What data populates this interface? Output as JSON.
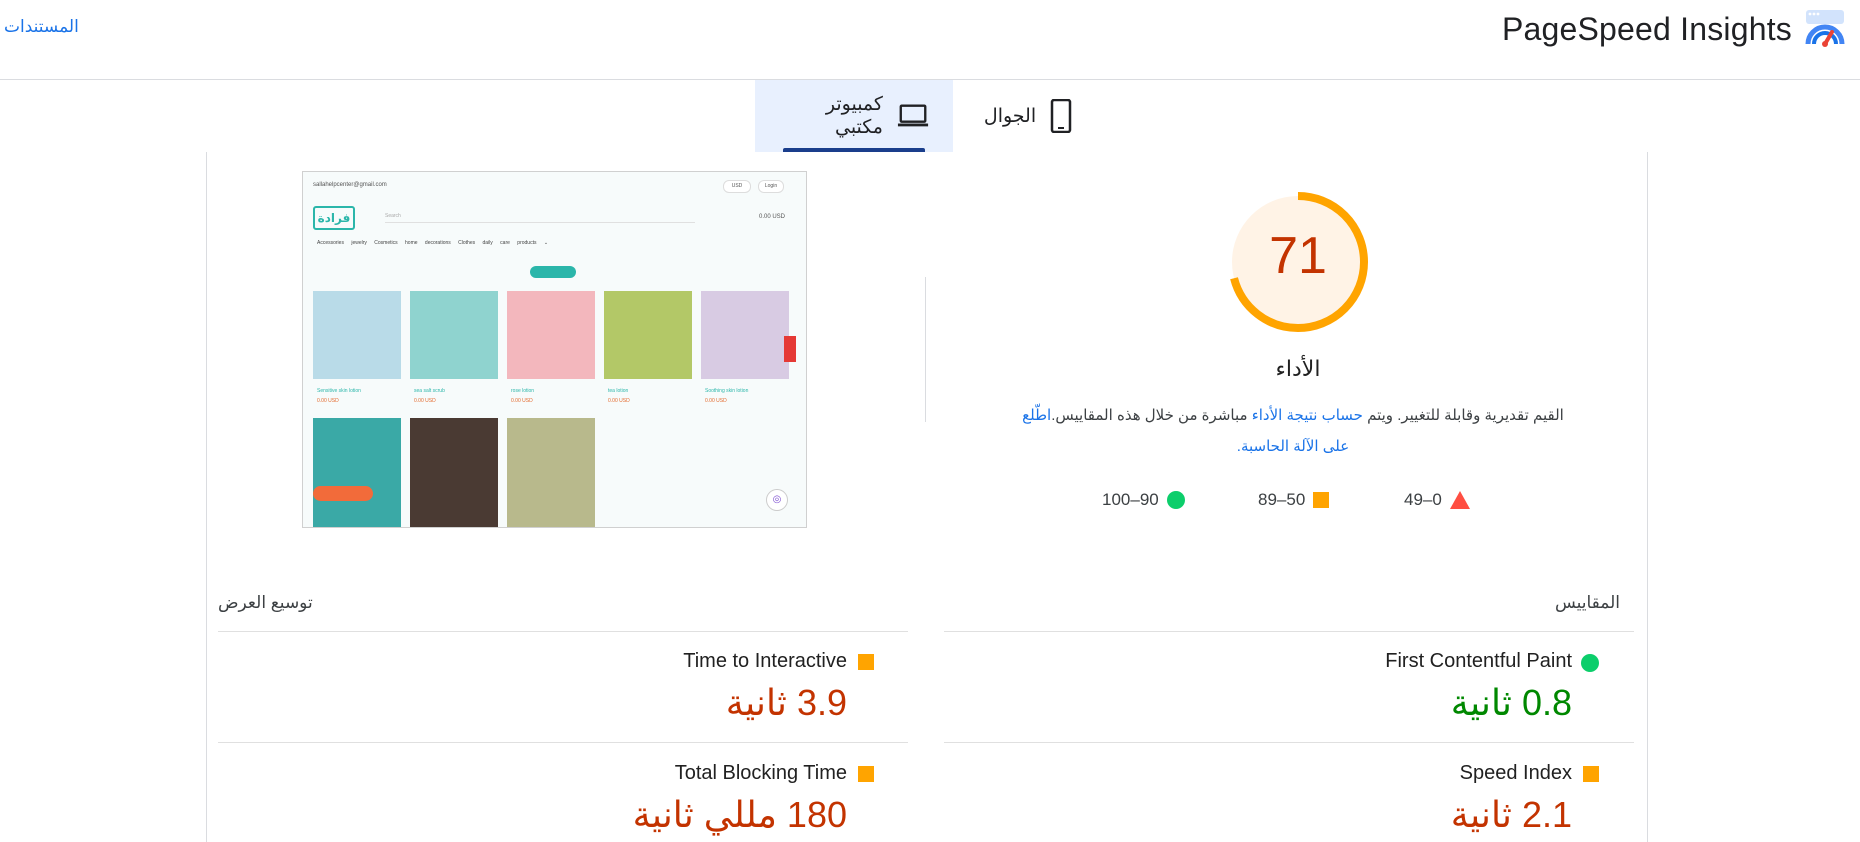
{
  "header": {
    "title": "PageSpeed Insights",
    "docs_link": "المستندات",
    "logo_icon": "pagespeed-gauge-logo"
  },
  "tabs": [
    {
      "label": "الجوال",
      "icon": "mobile-phone-icon",
      "active": false
    },
    {
      "label": "كمبيوتر مكتبي",
      "icon": "laptop-icon",
      "active": true
    }
  ],
  "score": {
    "value": "71",
    "fraction": 0.71,
    "label": "الأداء",
    "desc_part1": "القيم تقديرية وقابلة للتغيير. ويتم ",
    "desc_link1": "حساب نتيجة الأداء",
    "desc_part2": " مباشرة من خلال هذه المقاييس.",
    "desc_link2": "اطّلع على الآلة الحاسبة."
  },
  "legend": [
    {
      "range": "0–49",
      "icon": "triangle-red"
    },
    {
      "range": "50–89",
      "icon": "square-orange"
    },
    {
      "range": "90–100",
      "icon": "circle-green"
    }
  ],
  "screenshot": {
    "email": "sallahelpcenter@gmail.com",
    "currency": "USD",
    "login": "Login",
    "logo_text": "فرادة",
    "search": "Search",
    "nav": "Accessories   jewelry   Cosmetics   home decorations   Clothes   daily care products ⌄",
    "cart": "0.00 USD",
    "products": [
      {
        "name": "Sensitive skin lotion",
        "price": "0.00 USD"
      },
      {
        "name": "sea salt scrub",
        "price": "0.00 USD"
      },
      {
        "name": "rose lotion",
        "price": "0.00 USD"
      },
      {
        "name": "tea lotion",
        "price": "0.00 USD"
      },
      {
        "name": "Soothing skin lotion",
        "price": "0.00 USD"
      }
    ]
  },
  "metrics": {
    "heading": "المقاييس",
    "expand": "توسيع العرض",
    "items": [
      {
        "name": "First Contentful Paint",
        "value": "0.8 ثانية",
        "status": "good"
      },
      {
        "name": "Time to Interactive",
        "value": "3.9 ثانية",
        "status": "average"
      },
      {
        "name": "Speed Index",
        "value": "2.1 ثانية",
        "status": "average"
      },
      {
        "name": "Total Blocking Time",
        "value": "180 مللي ثانية",
        "status": "average"
      }
    ]
  },
  "colors": {
    "accent": "#1a73e8",
    "good": "#0cce6b",
    "average": "#ffa400",
    "poor": "#ff4e42",
    "score_text": "#c33300"
  }
}
